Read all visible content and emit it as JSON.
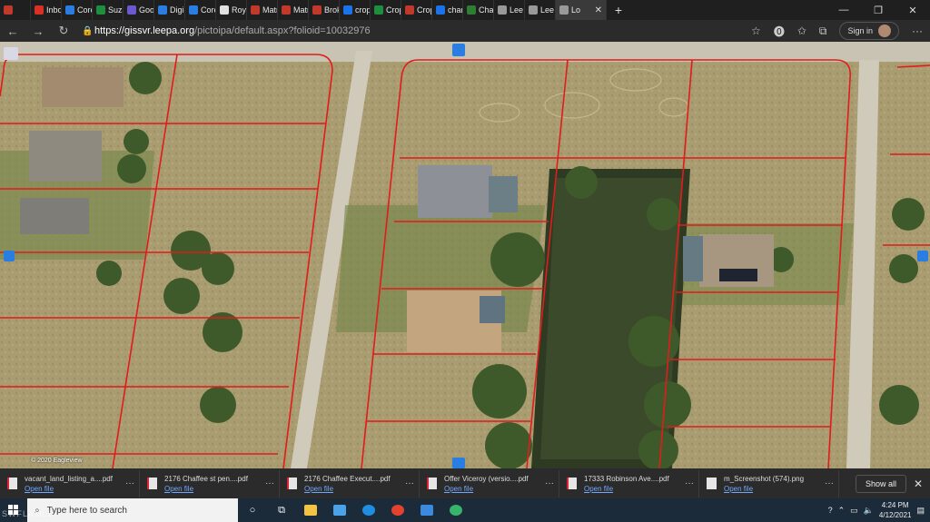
{
  "tabs": [
    {
      "label": "",
      "color": "#c0392b"
    },
    {
      "label": "Inbox",
      "color": "#d93025"
    },
    {
      "label": "Core |",
      "color": "#2a7de1"
    },
    {
      "label": "Suzan",
      "color": "#1e8e3e"
    },
    {
      "label": "Googl",
      "color": "#6a5acd"
    },
    {
      "label": "DigiSi",
      "color": "#2a7de1"
    },
    {
      "label": "Core |",
      "color": "#2a7de1"
    },
    {
      "label": "Royal",
      "color": "#e0e0e0"
    },
    {
      "label": "Matrix",
      "color": "#c0392b"
    },
    {
      "label": "Matrix",
      "color": "#c0392b"
    },
    {
      "label": "Broke",
      "color": "#c0392b"
    },
    {
      "label": "crop p",
      "color": "#1a73e8"
    },
    {
      "label": "Crop I",
      "color": "#1e8e3e"
    },
    {
      "label": "Crop a",
      "color": "#c0392b"
    },
    {
      "label": "charlo",
      "color": "#1a73e8"
    },
    {
      "label": "Charlo",
      "color": "#2e7d32"
    },
    {
      "label": "Lee Co",
      "color": "#999999"
    },
    {
      "label": "Lee Co",
      "color": "#999999"
    },
    {
      "label": "Lo",
      "color": "#999999",
      "active": true
    }
  ],
  "address": {
    "host": "https://gissvr.leepa.org",
    "path": "/pictoipa/default.aspx?folioid=10032976"
  },
  "signin_label": "Sign in",
  "map": {
    "copyright": "© 2020 Eagleview"
  },
  "downloads": [
    {
      "name": "vacant_land_listing_a....pdf",
      "open": "Open file",
      "type": "pdf"
    },
    {
      "name": "2176 Chaffee st pen....pdf",
      "open": "Open file",
      "type": "pdf"
    },
    {
      "name": "2176 Chaffee Execut....pdf",
      "open": "Open file",
      "type": "pdf"
    },
    {
      "name": "Offer Viceroy (versio....pdf",
      "open": "Open file",
      "type": "pdf"
    },
    {
      "name": "17333 Robinson Ave....pdf",
      "open": "Open file",
      "type": "pdf"
    },
    {
      "name": "m_Screenshot (574).png",
      "open": "Open file",
      "type": "png"
    }
  ],
  "show_all_label": "Show all",
  "taskbar": {
    "search_placeholder": "Type here to search",
    "time": "4:24 PM",
    "date": "4/12/2021"
  },
  "watermark": "SWFLAMLS"
}
